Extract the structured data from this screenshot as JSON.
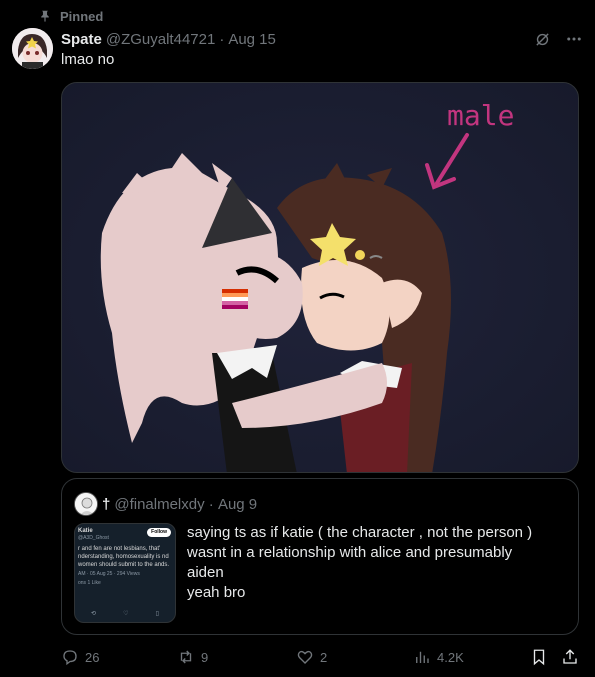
{
  "pinned": {
    "label": "Pinned",
    "icon": "pin-icon"
  },
  "post": {
    "author_name": "Spate",
    "handle": "@ZGuyalt44721",
    "date": "Aug 15",
    "text": "lmao no",
    "media": {
      "annotation_label": "male"
    }
  },
  "quote": {
    "author_name": "†",
    "handle": "@finalmelxdy",
    "date": "Aug 9",
    "lines": [
      "saying ts as if katie ( the character , not the person )",
      "wasnt in a relationship with alice and presumably",
      "aiden",
      "yeah bro"
    ],
    "thumb": {
      "name": "Katie",
      "handle": "@A3D_Ghost",
      "follow": "Follow",
      "body": "r and fen are not lesbians, that' nderstanding, homosexuality is nd women should submit to the ands.",
      "meta": "AM · 05 Aug 25 · 294 Views",
      "stats": "ons   1 Like"
    }
  },
  "actions": {
    "replies": "26",
    "reposts": "9",
    "likes": "2",
    "views": "4.2K"
  },
  "colors": {
    "accent_pink": "#c2357f",
    "muted": "#71767b",
    "text": "#e7e9ea",
    "border": "#2f3336"
  }
}
